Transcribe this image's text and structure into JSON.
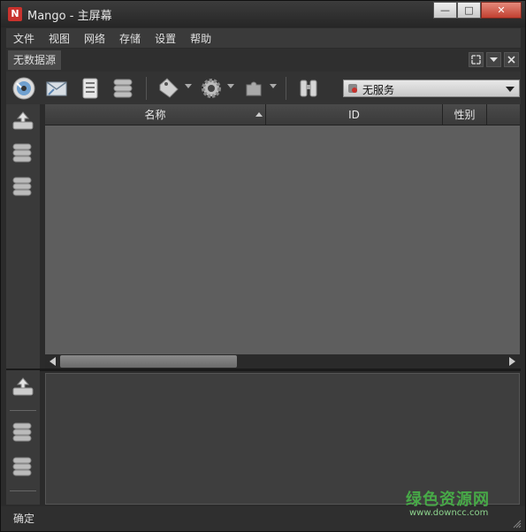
{
  "window": {
    "logo_letter": "N",
    "title": "Mango - 主屏幕",
    "controls": {
      "minimize": "—",
      "maximize": "□",
      "close": "✕"
    }
  },
  "menu": [
    "文件",
    "视图",
    "网络",
    "存储",
    "设置",
    "帮助"
  ],
  "tab": {
    "label": "无数据源"
  },
  "toolbar": {
    "service_combo": {
      "selected": "无服务",
      "icon": "service-icon"
    },
    "icons": [
      "cd-disc-icon",
      "mail-icon",
      "document-list-icon",
      "database-icon",
      "tag-icon",
      "gear-icon",
      "puzzle-icon",
      "binoculars-icon"
    ]
  },
  "table": {
    "columns": [
      {
        "label": "名称",
        "sorted": "ascending"
      },
      {
        "label": "ID"
      },
      {
        "label": "性别"
      }
    ],
    "rows": []
  },
  "status": {
    "text": "确定"
  },
  "watermark": {
    "text": "绿色资源网",
    "sub": "www.downcc.com"
  },
  "colors": {
    "accent": "#c8322d",
    "panel": "#5e5e5e",
    "dark": "#2b2b2b",
    "watermark": "#49b649"
  }
}
